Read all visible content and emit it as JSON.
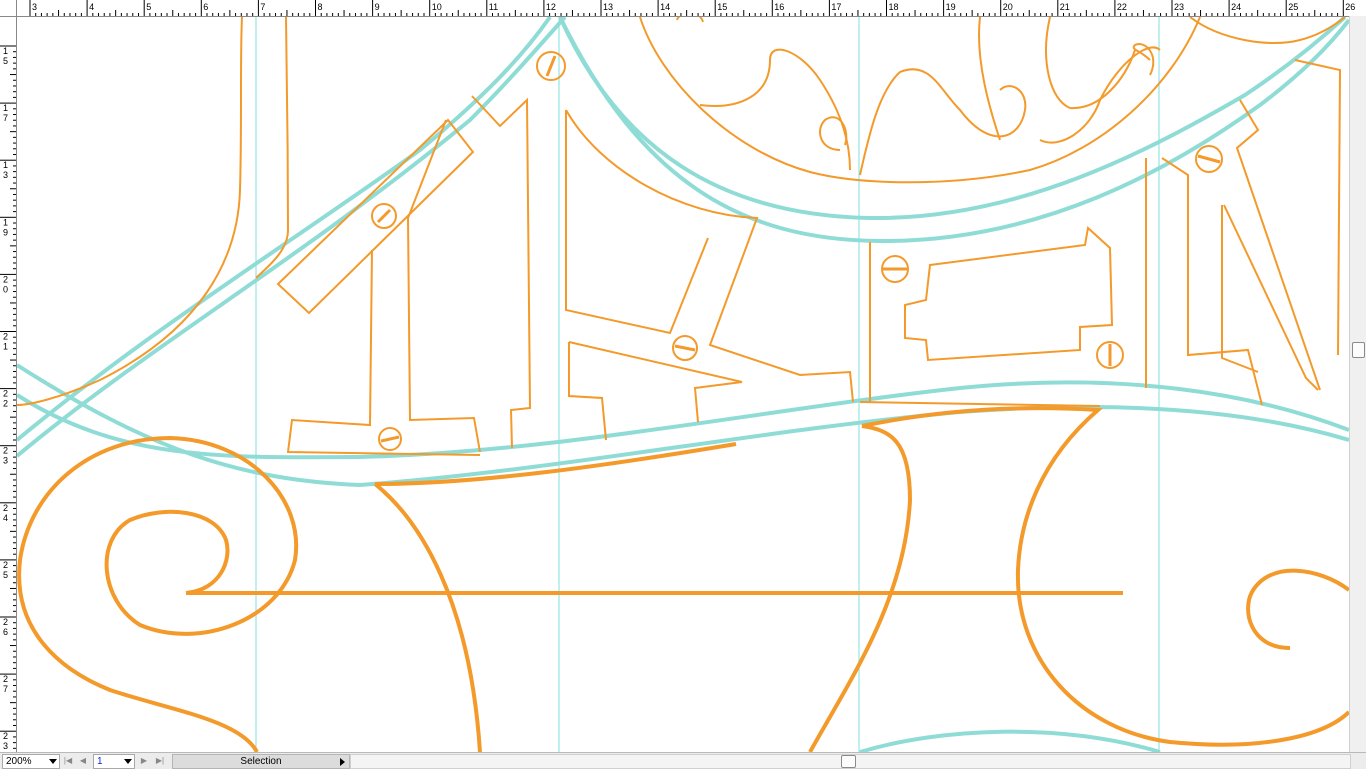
{
  "ruler": {
    "top_labels": [
      "3",
      "4",
      "5",
      "6",
      "7",
      "8",
      "9",
      "10",
      "11",
      "12",
      "13",
      "14",
      "15",
      "16",
      "17",
      "18",
      "19",
      "20",
      "21",
      "22",
      "23",
      "24",
      "25",
      "26"
    ],
    "left_labels": [
      "1\n5",
      "1\n7",
      "1\n3",
      "1\n9",
      "2\n0",
      "2\n1",
      "2\n2",
      "2\n3",
      "2\n4",
      "2\n5",
      "2\n6",
      "2\n7",
      "2\n3"
    ]
  },
  "status": {
    "zoom": "200%",
    "page": "1",
    "tool_mode": "Selection"
  },
  "colors": {
    "orange": "#f39a2b",
    "cyan": "#8fdcd6",
    "guide": "#7fe0e0"
  },
  "icons": {
    "first_page": "first-page-icon",
    "prev_page": "prev-page-icon",
    "next_page": "next-page-icon",
    "last_page": "last-page-icon"
  }
}
